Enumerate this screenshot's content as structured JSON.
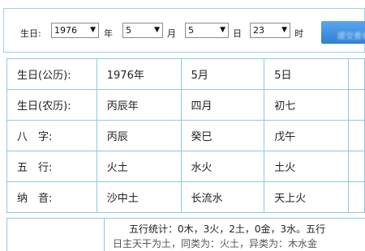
{
  "form": {
    "birth_label": "生日:",
    "year_value": "1976",
    "year_unit": "年",
    "month_value": "5",
    "month_unit": "月",
    "day_value": "5",
    "day_unit": "日",
    "hour_value": "23",
    "hour_unit": "时",
    "submit_label": "提交查询"
  },
  "table": {
    "rows": [
      {
        "label": "生日(公历):",
        "c1": "1976年",
        "c2": "5月",
        "c3": "5日"
      },
      {
        "label": "生日(农历):",
        "c1": "丙辰年",
        "c2": "四月",
        "c3": "初七"
      },
      {
        "label": "八　字:",
        "c1": "丙辰",
        "c2": "癸巳",
        "c3": "戊午"
      },
      {
        "label": "五　行:",
        "c1": "火土",
        "c2": "水火",
        "c3": "土火"
      },
      {
        "label": "纳　音:",
        "c1": "沙中土",
        "c2": "长流水",
        "c3": "天上火"
      }
    ]
  },
  "summary": {
    "line1": "五行统计：0木，3火，2土，0金，3水。五行",
    "line2": "日主天干为土，同类为：火土，异类为：木水金"
  }
}
